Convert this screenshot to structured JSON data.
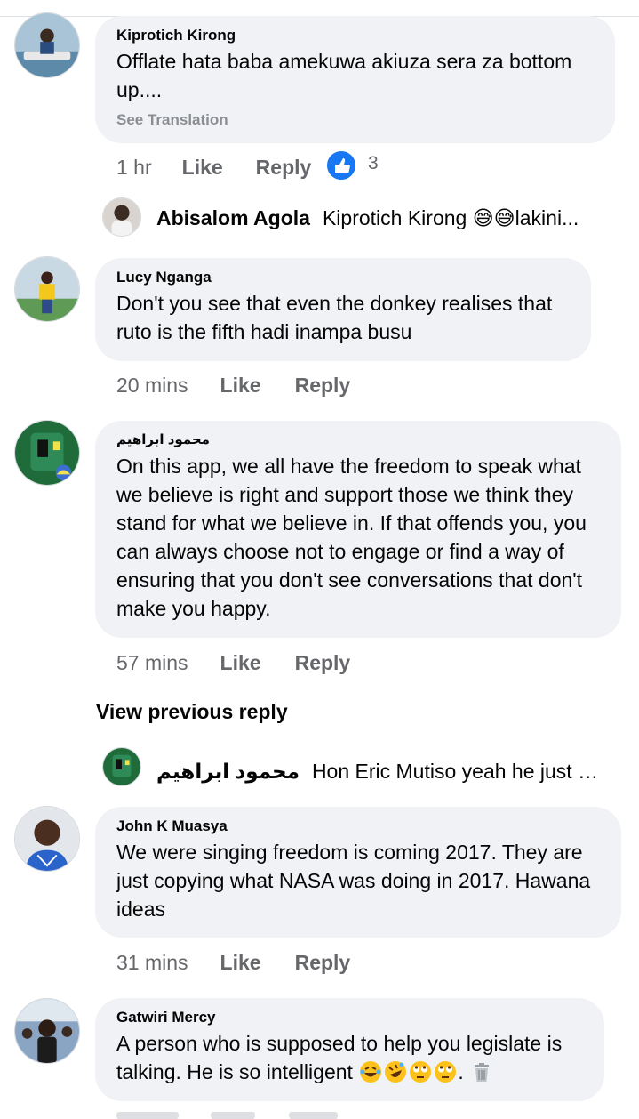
{
  "comments": [
    {
      "author": "Kiprotich Kirong",
      "text": "Offlate hata baba amekuwa akiuza sera za bottom up....",
      "see_translation": "See Translation",
      "time": "1 hr",
      "like": "Like",
      "reply": "Reply",
      "reaction_count": "3",
      "avatar_icon": "person-on-boat-avatar",
      "reply_preview": {
        "author": "Abisalom Agola",
        "text": "Kiprotich Kirong 😅😅lakini..."
      }
    },
    {
      "author": "Lucy Nganga",
      "text": "Don't you see that even the donkey realises that ruto is the fifth hadi inampa busu",
      "time": "20 mins",
      "like": "Like",
      "reply": "Reply",
      "avatar_icon": "person-in-yellow-avatar"
    },
    {
      "author": "محمود ابراهيم",
      "text": "On this app, we all have the freedom to speak what we believe is right and support those we think they stand for what we believe in. If that offends you, you can always choose not to engage or find a way of ensuring that you don't see conversations that don't make you happy.",
      "time": "57 mins",
      "like": "Like",
      "reply": "Reply",
      "avatar_icon": "green-machine-avatar",
      "view_previous": "View previous reply",
      "reply_preview": {
        "author": "محمود ابراهيم",
        "text": "Hon Eric Mutiso yeah he just del..."
      }
    },
    {
      "author": "John K Muasya",
      "text": "We were singing freedom is coming 2017. They are just copying what NASA was doing in 2017. Hawana ideas",
      "time": "31 mins",
      "like": "Like",
      "reply": "Reply",
      "avatar_icon": "man-portrait-avatar"
    },
    {
      "author": "Gatwiri Mercy",
      "text": "A person who is supposed to help you legislate is talking. He is so intelligent",
      "text_suffix": ". ",
      "emojis": [
        "laughing-tears-emoji",
        "rolling-laughing-emoji",
        "eye-roll-emoji",
        "eye-roll-emoji",
        "trash-can-emoji"
      ],
      "avatar_icon": "woman-crowd-avatar"
    }
  ],
  "colors": {
    "bubble": "#f0f2f5",
    "secondary_text": "#65676b",
    "like_blue": "#1877f2"
  }
}
